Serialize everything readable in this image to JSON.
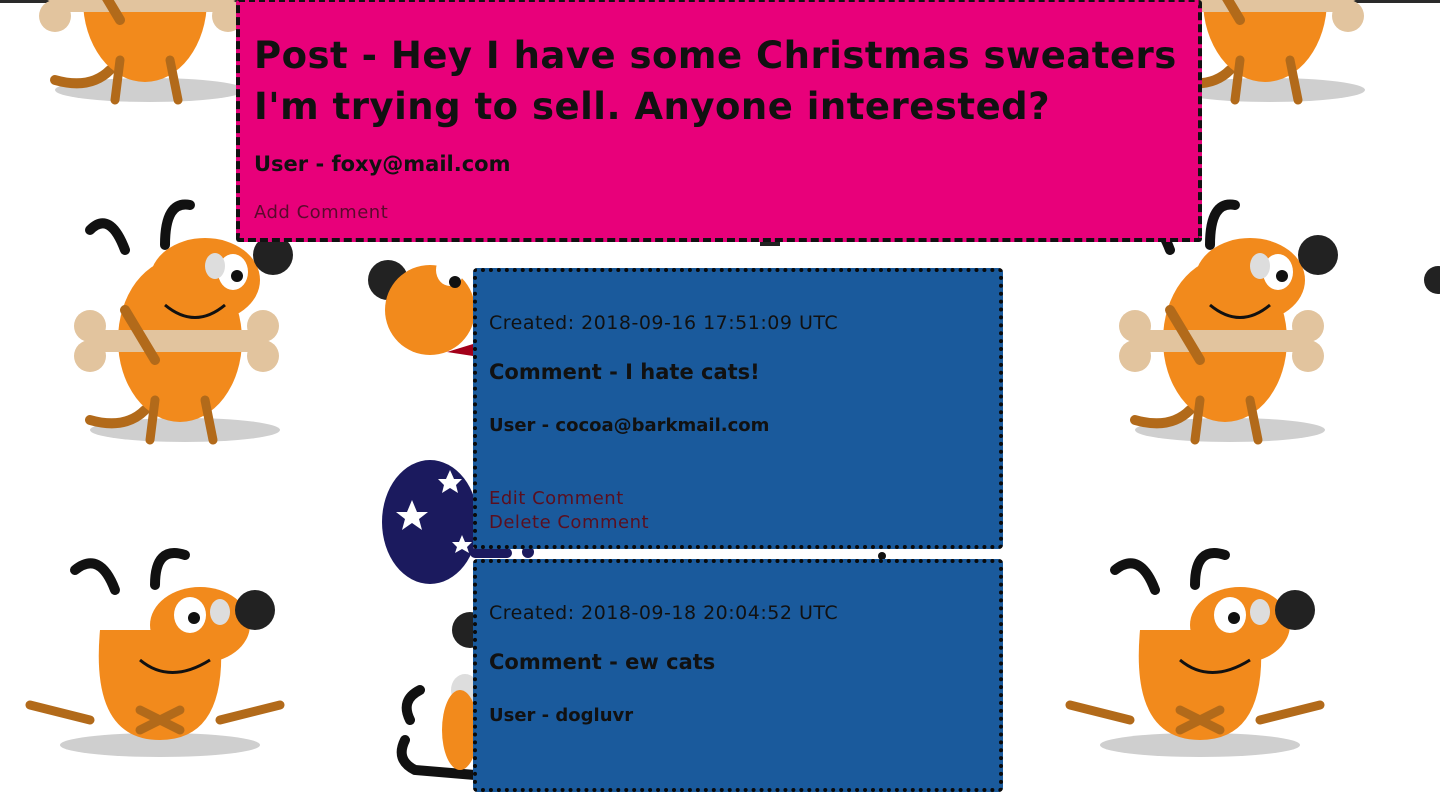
{
  "post": {
    "title": "Post - Hey I have some Christmas sweaters I'm trying to sell. Anyone interested?",
    "user": "User - foxy@mail.com",
    "add_comment": "Add Comment"
  },
  "comments": [
    {
      "created": "Created: 2018-09-16 17:51:09 UTC",
      "comment": "Comment - I hate cats!",
      "user": "User - cocoa@barkmail.com",
      "edit": "Edit Comment",
      "delete": "Delete Comment"
    },
    {
      "created": "Created: 2018-09-18 20:04:52 UTC",
      "comment": "Comment - ew cats",
      "user": "User - dogluvr"
    }
  ],
  "colors": {
    "post_bg": "#e8007a",
    "comment_bg": "#1a5a9c",
    "dog_orange": "#f28a1c",
    "link_dark": "#5a0a2c"
  },
  "background": {
    "icon": "cartoon-dog-pattern"
  }
}
